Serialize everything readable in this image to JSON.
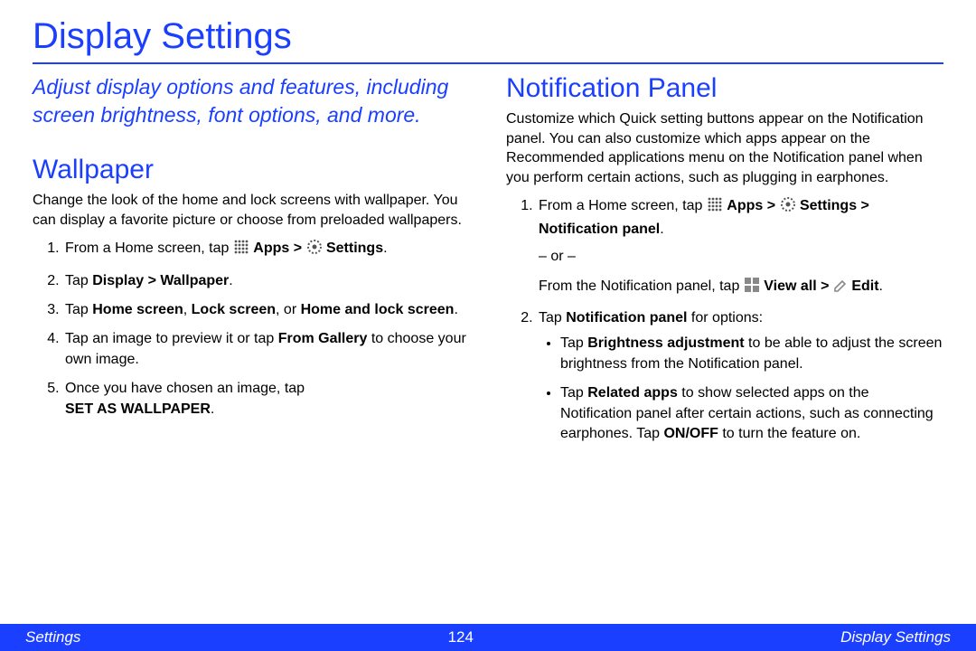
{
  "title": "Display Settings",
  "intro": "Adjust display options and features, including screen brightness, font options, and more.",
  "wallpaper": {
    "heading": "Wallpaper",
    "desc": "Change the look of the home and lock screens with wallpaper. You can display a favorite picture or choose from preloaded wallpapers.",
    "step1_a": "From a Home screen, tap ",
    "step1_apps": "Apps",
    "step1_gt": " > ",
    "step1_settings": "Settings",
    "step1_dot": ".",
    "step2_a": "Tap ",
    "step2_b": "Display > Wallpaper",
    "step2_dot": ".",
    "step3_a": "Tap ",
    "step3_b": "Home screen",
    "step3_c": ", ",
    "step3_d": "Lock screen",
    "step3_e": ", or ",
    "step3_f": "Home and lock screen",
    "step3_dot": ".",
    "step4_a": "Tap an image to preview it or tap ",
    "step4_b": "From Gallery",
    "step4_c": " to choose your own image.",
    "step5_a": "Once you have chosen an image, tap ",
    "step5_b": "SET AS WALLPAPER",
    "step5_dot": "."
  },
  "notif": {
    "heading": "Notification Panel",
    "desc": "Customize which Quick setting buttons appear on the Notification panel. You can also customize which apps appear on the Recommended applications menu on the Notification panel when you perform certain actions, such as plugging in earphones.",
    "step1_a": "From a Home screen, tap ",
    "step1_apps": "Apps",
    "step1_gt": " > ",
    "step1_settings": "Settings",
    "step1_gt2": " > ",
    "step1_np": "Notification panel",
    "step1_dot": ".",
    "or": "– or –",
    "step1b_a": "From the Notification panel, tap ",
    "step1b_view": "View all",
    "step1b_gt": " > ",
    "step1b_edit": "Edit",
    "step1b_dot": ".",
    "step2_a": "Tap ",
    "step2_b": "Notification panel",
    "step2_c": " for options:",
    "bullet1_a": "Tap ",
    "bullet1_b": "Brightness adjustment",
    "bullet1_c": " to be able to adjust the screen brightness from the Notification panel.",
    "bullet2_a": "Tap ",
    "bullet2_b": "Related apps",
    "bullet2_c": " to show selected apps on the Notification panel after certain actions, such as connecting earphones. Tap ",
    "bullet2_d": "ON/OFF",
    "bullet2_e": " to turn the feature on."
  },
  "footer": {
    "left": "Settings",
    "center": "124",
    "right": "Display Settings"
  }
}
